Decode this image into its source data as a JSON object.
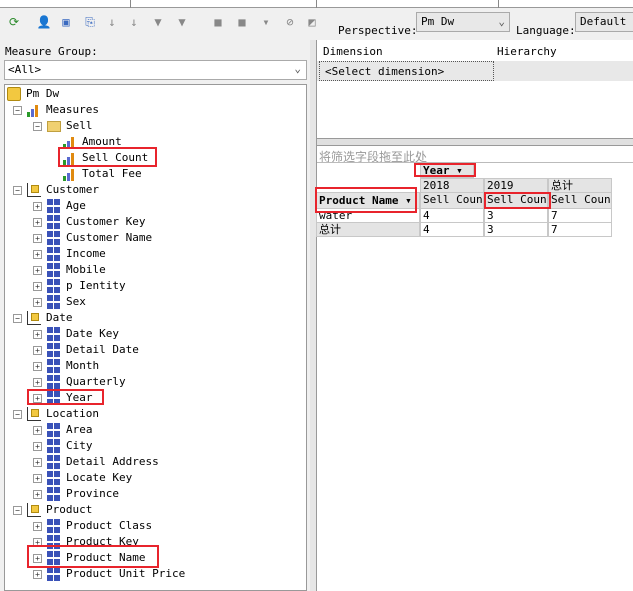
{
  "toolbar": {
    "perspective_label": "Perspective:",
    "perspective_value": "Pm Dw",
    "language_label": "Language:",
    "language_value": "Default"
  },
  "left": {
    "measure_group_label": "Measure Group:",
    "measure_group_value": "<All>"
  },
  "tree": [
    {
      "label": "Pm Dw",
      "level": 0,
      "icon": "cube-icon",
      "toggle": ""
    },
    {
      "label": "Measures",
      "level": 1,
      "icon": "measures-icon",
      "toggle": "-"
    },
    {
      "label": "Sell",
      "level": 2,
      "icon": "folder-open-icon",
      "toggle": "-"
    },
    {
      "label": "Amount",
      "level": 3,
      "icon": "measure-icon",
      "toggle": ""
    },
    {
      "label": "Sell Count",
      "level": 3,
      "icon": "measure-icon",
      "toggle": ""
    },
    {
      "label": "Total Fee",
      "level": 3,
      "icon": "measure-icon",
      "toggle": ""
    },
    {
      "label": "Customer",
      "level": 1,
      "icon": "dimension-icon",
      "toggle": "-"
    },
    {
      "label": "Age",
      "level": 2,
      "icon": "attribute-icon",
      "toggle": "+"
    },
    {
      "label": "Customer Key",
      "level": 2,
      "icon": "attribute-icon",
      "toggle": "+"
    },
    {
      "label": "Customer Name",
      "level": 2,
      "icon": "attribute-icon",
      "toggle": "+"
    },
    {
      "label": "Income",
      "level": 2,
      "icon": "attribute-icon",
      "toggle": "+"
    },
    {
      "label": "Mobile",
      "level": 2,
      "icon": "attribute-icon",
      "toggle": "+"
    },
    {
      "label": "p Ientity",
      "level": 2,
      "icon": "attribute-icon",
      "toggle": "+"
    },
    {
      "label": "Sex",
      "level": 2,
      "icon": "attribute-icon",
      "toggle": "+"
    },
    {
      "label": "Date",
      "level": 1,
      "icon": "dimension-icon",
      "toggle": "-"
    },
    {
      "label": "Date Key",
      "level": 2,
      "icon": "attribute-icon",
      "toggle": "+"
    },
    {
      "label": "Detail Date",
      "level": 2,
      "icon": "attribute-icon",
      "toggle": "+"
    },
    {
      "label": "Month",
      "level": 2,
      "icon": "attribute-icon",
      "toggle": "+"
    },
    {
      "label": "Quarterly",
      "level": 2,
      "icon": "attribute-icon",
      "toggle": "+"
    },
    {
      "label": "Year",
      "level": 2,
      "icon": "attribute-icon",
      "toggle": "+"
    },
    {
      "label": "Location",
      "level": 1,
      "icon": "dimension-icon",
      "toggle": "-"
    },
    {
      "label": "Area",
      "level": 2,
      "icon": "attribute-icon",
      "toggle": "+"
    },
    {
      "label": "City",
      "level": 2,
      "icon": "attribute-icon",
      "toggle": "+"
    },
    {
      "label": "Detail Address",
      "level": 2,
      "icon": "attribute-icon",
      "toggle": "+"
    },
    {
      "label": "Locate Key",
      "level": 2,
      "icon": "attribute-icon",
      "toggle": "+"
    },
    {
      "label": "Province",
      "level": 2,
      "icon": "attribute-icon",
      "toggle": "+"
    },
    {
      "label": "Product",
      "level": 1,
      "icon": "dimension-icon",
      "toggle": "-"
    },
    {
      "label": "Product Class",
      "level": 2,
      "icon": "attribute-icon",
      "toggle": "+"
    },
    {
      "label": "Product Key",
      "level": 2,
      "icon": "attribute-icon",
      "toggle": "+"
    },
    {
      "label": "Product Name",
      "level": 2,
      "icon": "attribute-icon",
      "toggle": "+"
    },
    {
      "label": "Product Unit Price",
      "level": 2,
      "icon": "attribute-icon",
      "toggle": "+"
    }
  ],
  "filter": {
    "col_dimension": "Dimension",
    "col_hierarchy": "Hierarchy",
    "select_dimension": "<Select dimension>"
  },
  "pivot": {
    "drop_hint": "将筛选字段拖至此处",
    "column_field": "Year ▾",
    "row_field": "Product Name ▾",
    "column_headers": [
      "2018",
      "2019",
      "总计"
    ],
    "measure_headers": [
      "Sell Count",
      "Sell Count",
      "Sell Count"
    ],
    "rows": [
      {
        "label": "water",
        "values": [
          "4",
          "3",
          "7"
        ]
      },
      {
        "label": "总计",
        "values": [
          "4",
          "3",
          "7"
        ]
      }
    ]
  },
  "colors": {
    "highlight": "#e8242c"
  }
}
